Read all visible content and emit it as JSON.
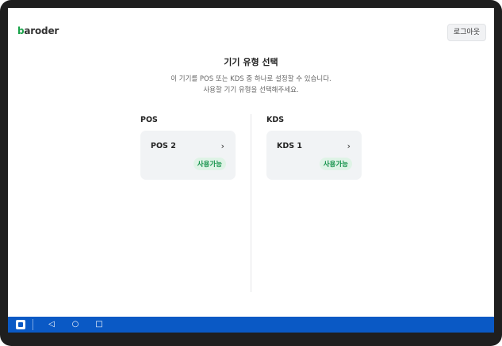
{
  "header": {
    "logo_prefix": "b",
    "logo_rest": "aroder",
    "logout_label": "로그아웃"
  },
  "main": {
    "title": "기기 유형 선택",
    "desc_line1": "이 기기를 POS 또는 KDS 중 하나로 설정할 수 있습니다.",
    "desc_line2": "사용할 기기 유형을 선택해주세요."
  },
  "sections": [
    {
      "title": "POS",
      "devices": [
        {
          "name": "POS 2",
          "status": "사용가능"
        }
      ]
    },
    {
      "title": "KDS",
      "devices": [
        {
          "name": "KDS 1",
          "status": "사용가능"
        }
      ]
    }
  ],
  "navbar": {
    "back_glyph": "◁",
    "home_glyph": "○",
    "recents_glyph": "□"
  },
  "colors": {
    "brand_green": "#1aa34a",
    "nav_blue": "#0a59c5",
    "badge_bg": "#dff3e6",
    "badge_text": "#14924a"
  },
  "icons": {
    "chevron": "›"
  }
}
